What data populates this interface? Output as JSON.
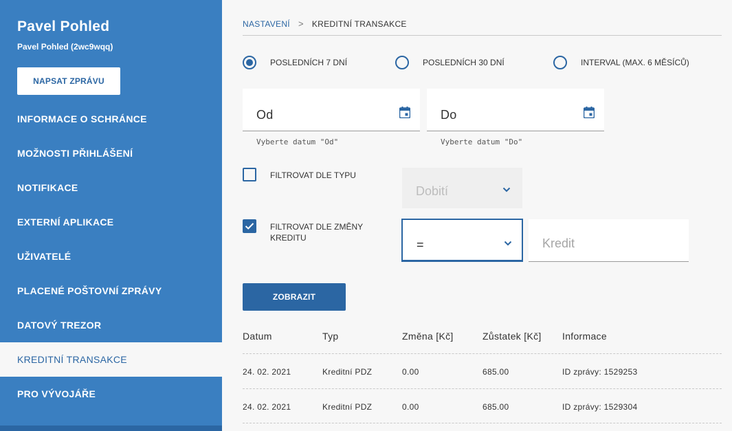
{
  "sidebar": {
    "user_name": "Pavel Pohled",
    "user_sub": "Pavel Pohled (2wc9wqq)",
    "write_button": "NAPSAT ZPRÁVU",
    "items": [
      {
        "label": "INFORMACE O SCHRÁNCE"
      },
      {
        "label": "MOŽNOSTI PŘIHLÁŠENÍ"
      },
      {
        "label": "NOTIFIKACE"
      },
      {
        "label": "EXTERNÍ APLIKACE"
      },
      {
        "label": "UŽIVATELÉ"
      },
      {
        "label": "PLACENÉ POŠTOVNÍ ZPRÁVY"
      },
      {
        "label": "DATOVÝ TREZOR"
      },
      {
        "label": "KREDITNÍ TRANSAKCE",
        "active": true
      },
      {
        "label": "PRO VÝVOJÁŘE"
      }
    ]
  },
  "breadcrumb": {
    "parent": "NASTAVENÍ",
    "separator": ">",
    "current": "KREDITNÍ TRANSAKCE"
  },
  "period": {
    "options": [
      {
        "label": "POSLEDNÍCH 7 DNÍ",
        "selected": true
      },
      {
        "label": "POSLEDNÍCH 30 DNÍ",
        "selected": false
      },
      {
        "label": "INTERVAL (MAX. 6 MĚSÍCŮ)",
        "selected": false
      }
    ]
  },
  "date_from": {
    "label": "Od",
    "helper": "Vyberte datum \"Od\"",
    "icon": "calendar-icon"
  },
  "date_to": {
    "label": "Do",
    "helper": "Vyberte datum \"Do\"",
    "icon": "calendar-icon"
  },
  "filter_type": {
    "label": "FILTROVAT DLE TYPU",
    "checked": false,
    "select_value": "Dobití",
    "disabled": true
  },
  "filter_credit": {
    "label_line1": "FILTROVAT DLE ZMĚNY",
    "label_line2": "KREDITU",
    "checked": true,
    "operator": "=",
    "amount_placeholder": "Kredit"
  },
  "show_button": "ZOBRAZIT",
  "table": {
    "columns": [
      "Datum",
      "Typ",
      "Změna [Kč]",
      "Zůstatek [Kč]",
      "Informace"
    ],
    "rows": [
      [
        "24. 02. 2021",
        "Kreditní PDZ",
        "0.00",
        "685.00",
        "ID zprávy: 1529253"
      ],
      [
        "24. 02. 2021",
        "Kreditní PDZ",
        "0.00",
        "685.00",
        "ID zprávy: 1529304"
      ]
    ]
  },
  "colors": {
    "sidebar": "#3a7fc1",
    "accent": "#2b66a3",
    "background": "#f7f7f7"
  }
}
